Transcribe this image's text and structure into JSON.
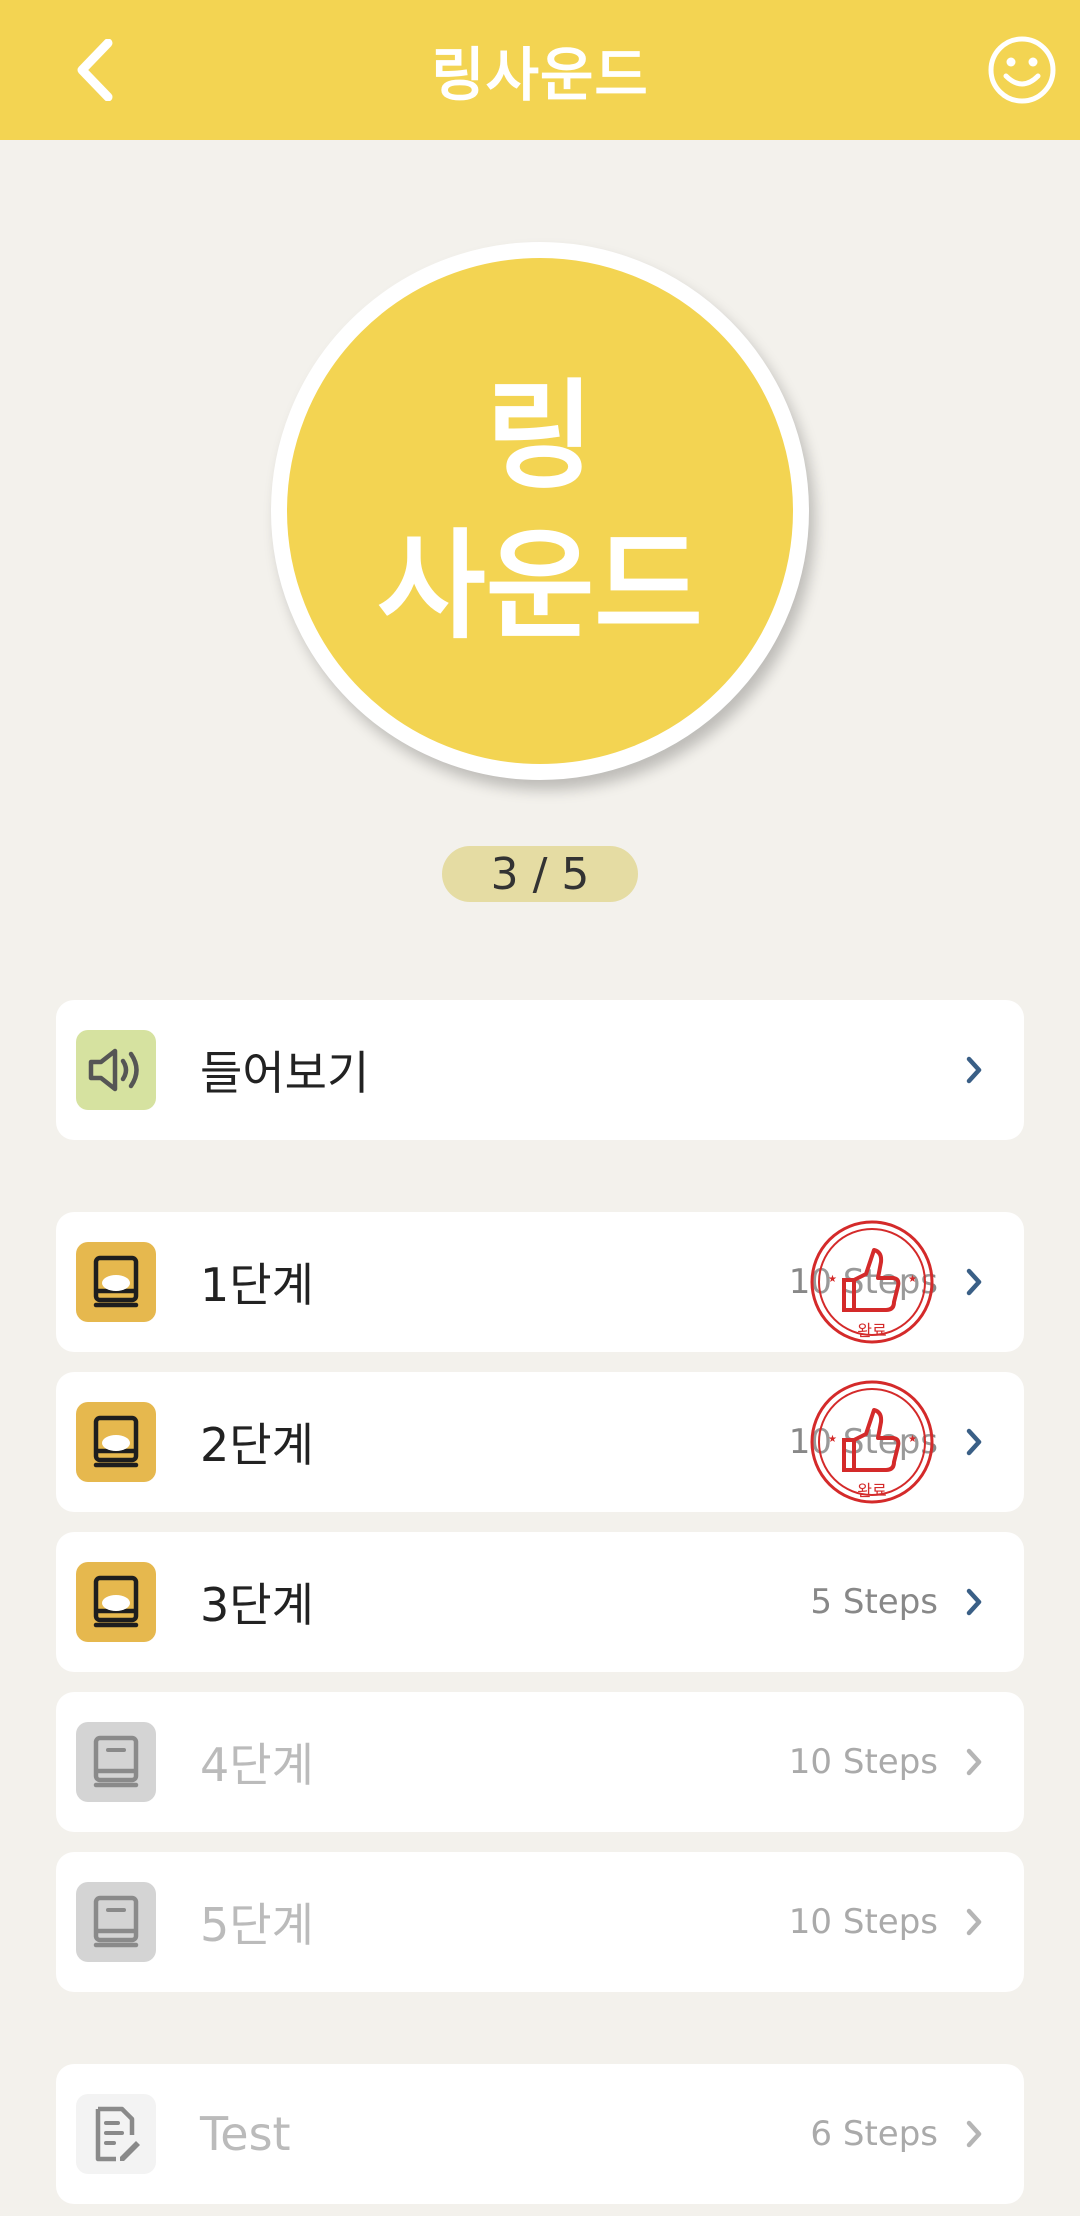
{
  "header": {
    "title": "링사운드",
    "back_icon": "chevron-left-icon",
    "right_icon": "smiley-icon"
  },
  "hero": {
    "line1": "링",
    "line2": "사운드"
  },
  "progress": {
    "text": "3 / 5",
    "current": 3,
    "total": 5
  },
  "listen": {
    "label": "들어보기",
    "icon": "speaker-icon"
  },
  "levels": [
    {
      "label": "1단계",
      "steps": "10 Steps",
      "completed": true,
      "enabled": true
    },
    {
      "label": "2단계",
      "steps": "10 Steps",
      "completed": true,
      "enabled": true
    },
    {
      "label": "3단계",
      "steps": "5 Steps",
      "completed": false,
      "enabled": true
    },
    {
      "label": "4단계",
      "steps": "10 Steps",
      "completed": false,
      "enabled": false
    },
    {
      "label": "5단계",
      "steps": "10 Steps",
      "completed": false,
      "enabled": false
    }
  ],
  "stamp": {
    "text": "완료",
    "icon": "thumbs-up-stamp-icon"
  },
  "test": {
    "label": "Test",
    "steps": "6 Steps",
    "icon": "test-sheet-icon"
  },
  "colors": {
    "brand_yellow": "#f3d452",
    "background": "#f3f1ec",
    "active_icon_bg": "#e6b84e",
    "disabled_icon_bg": "#d4d4d4",
    "listen_icon_bg": "#d6e2a0",
    "chevron_active": "#3a5f86",
    "stamp_red": "#d42a2a"
  }
}
